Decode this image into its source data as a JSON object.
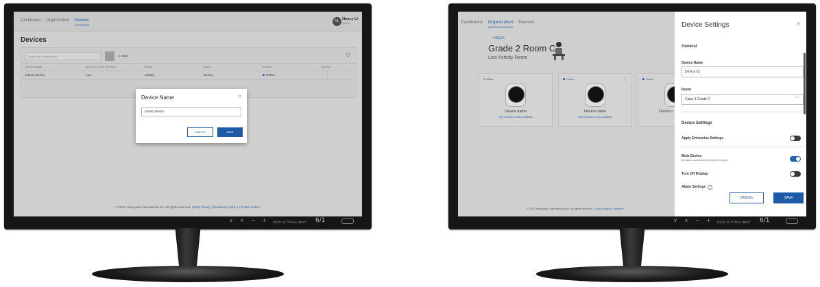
{
  "left": {
    "nav": [
      "Dashboard",
      "Organization",
      "Devices"
    ],
    "active_nav": "Devices",
    "user": {
      "initials": "NL",
      "name": "Nancy Li",
      "role": "Admin"
    },
    "page_title": "Devices",
    "search_placeholder": "Search for device name",
    "total": "1 Total",
    "columns": [
      "DEVICE NAME",
      "ACTIVITY LEVEL SETTING",
      "ROOM",
      "BUILD",
      "STATUS",
      "ACTION"
    ],
    "row": [
      "Library Device",
      "Low",
      "Library",
      "Device",
      "Online",
      "⋮"
    ],
    "footer": {
      "copyright": "© 2021 Honeywell International Inc. All rights reserved.",
      "links": [
        "Data Privacy",
        "Disclaimer",
        "EULA",
        "Cookie Notice"
      ]
    },
    "modal": {
      "title": "Device Name",
      "value": "Library Device",
      "cancel": "CANCEL",
      "save": "SAVE"
    }
  },
  "right": {
    "nav": [
      "Dashboard",
      "Organization",
      "Devices"
    ],
    "active_nav": "Organization",
    "back": "< BACK",
    "room_title": "Grade 2 Room C",
    "room_sub": "Low Activity Room",
    "cards": [
      {
        "status": "Offline",
        "name": "Device name",
        "firmware": "New Firmware version available"
      },
      {
        "status": "Online",
        "name": "Device name",
        "firmware": "New Firmware version available"
      },
      {
        "status": "Online",
        "name": "Device r",
        "firmware": ""
      }
    ],
    "footer": {
      "copyright": "© 2021 Honeywell International Inc. All rights reserved.",
      "links": [
        "Data Privacy",
        "Disclaim"
      ]
    },
    "panel": {
      "title": "Device Settings",
      "general": "General",
      "device_name_label": "Device Name",
      "device_name_value": "Device 01",
      "room_label": "Room",
      "room_value": "Class 1 Grade 2",
      "device_settings": "Device Settings",
      "apply_enterprise": "Apply  Enterprise  Settings",
      "mute_device": "Mute Device",
      "mute_desc": "No alarm sound when the device is in alarm",
      "turn_off_display": "Turn Off Display",
      "alarm_settings": "Alarm Settings",
      "help": "?",
      "cancel": "CANCEL",
      "save": "SAVE",
      "toggles": {
        "apply_enterprise": false,
        "mute_device": true,
        "turn_off_display": false
      }
    }
  },
  "monitor_controls": {
    "arrows": [
      "∨",
      "∧",
      "−",
      "+"
    ],
    "labels": "OK/IR  SETTINGS  INPUT",
    "brand": "6/1"
  },
  "colors": {
    "accent": "#1f5aa6",
    "link": "#245ea8",
    "bezel": "#161616"
  }
}
